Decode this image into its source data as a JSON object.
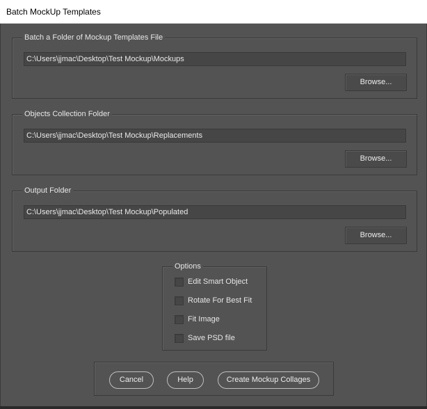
{
  "window": {
    "title": "Batch MockUp Templates"
  },
  "templates_section": {
    "legend": "Batch a Folder of Mockup Templates File",
    "path": "C:\\Users\\jjmac\\Desktop\\Test Mockup\\Mockups",
    "browse_label": "Browse..."
  },
  "objects_section": {
    "legend": "Objects Collection Folder",
    "path": "C:\\Users\\jjmac\\Desktop\\Test Mockup\\Replacements",
    "browse_label": "Browse..."
  },
  "output_section": {
    "legend": "Output Folder",
    "path": "C:\\Users\\jjmac\\Desktop\\Test Mockup\\Populated",
    "browse_label": "Browse..."
  },
  "options": {
    "legend": "Options",
    "items": [
      {
        "label": "Edit Smart Object",
        "checked": false
      },
      {
        "label": "Rotate For Best Fit",
        "checked": false
      },
      {
        "label": "Fit Image",
        "checked": false
      },
      {
        "label": "Save PSD file",
        "checked": false
      }
    ]
  },
  "buttons": {
    "cancel": "Cancel",
    "help": "Help",
    "create": "Create Mockup Collages"
  }
}
